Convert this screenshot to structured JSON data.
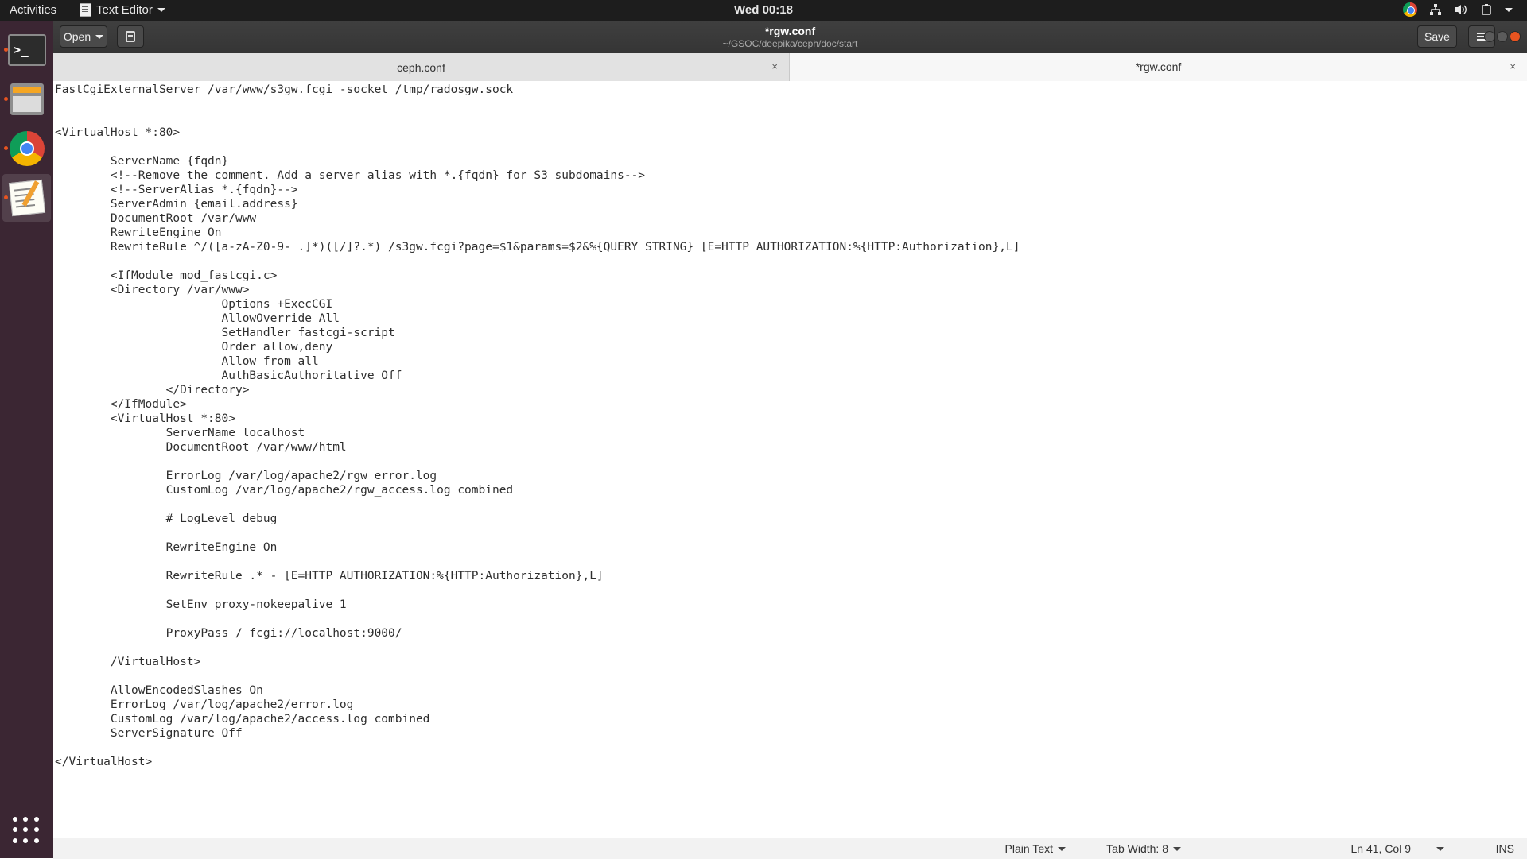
{
  "topbar": {
    "activities": "Activities",
    "app_name": "Text Editor",
    "clock": "Wed 00:18"
  },
  "window": {
    "title": "*rgw.conf",
    "path": "~/GSOC/deepika/ceph/doc/start",
    "open_label": "Open",
    "save_label": "Save"
  },
  "tabs": [
    {
      "label": "ceph.conf",
      "close": "×"
    },
    {
      "label": "*rgw.conf",
      "close": "×"
    }
  ],
  "editor": {
    "content": "FastCgiExternalServer /var/www/s3gw.fcgi -socket /tmp/radosgw.sock\n\n\n<VirtualHost *:80>\n\n        ServerName {fqdn}\n        <!--Remove the comment. Add a server alias with *.{fqdn} for S3 subdomains-->\n        <!--ServerAlias *.{fqdn}-->\n        ServerAdmin {email.address}\n        DocumentRoot /var/www\n        RewriteEngine On\n        RewriteRule ^/([a-zA-Z0-9-_.]*)([/]?.*) /s3gw.fcgi?page=$1&params=$2&%{QUERY_STRING} [E=HTTP_AUTHORIZATION:%{HTTP:Authorization},L]\n\n        <IfModule mod_fastcgi.c>\n        <Directory /var/www>\n                        Options +ExecCGI\n                        AllowOverride All\n                        SetHandler fastcgi-script\n                        Order allow,deny\n                        Allow from all\n                        AuthBasicAuthoritative Off\n                </Directory>\n        </IfModule>\n        <VirtualHost *:80>\n                ServerName localhost\n                DocumentRoot /var/www/html\n\n                ErrorLog /var/log/apache2/rgw_error.log\n                CustomLog /var/log/apache2/rgw_access.log combined\n\n                # LogLevel debug\n\n                RewriteEngine On\n\n                RewriteRule .* - [E=HTTP_AUTHORIZATION:%{HTTP:Authorization},L]\n\n                SetEnv proxy-nokeepalive 1\n\n                ProxyPass / fcgi://localhost:9000/\n\n        /VirtualHost>\n\n        AllowEncodedSlashes On\n        ErrorLog /var/log/apache2/error.log\n        CustomLog /var/log/apache2/access.log combined\n        ServerSignature Off\n\n</VirtualHost>"
  },
  "statusbar": {
    "language": "Plain Text",
    "tab_width": "Tab Width: 8",
    "position": "Ln 41, Col 9",
    "mode": "INS"
  },
  "colors": {
    "accent": "#e95420",
    "dock_bg": "#3b2633",
    "topbar_bg": "#1d1d1d"
  }
}
